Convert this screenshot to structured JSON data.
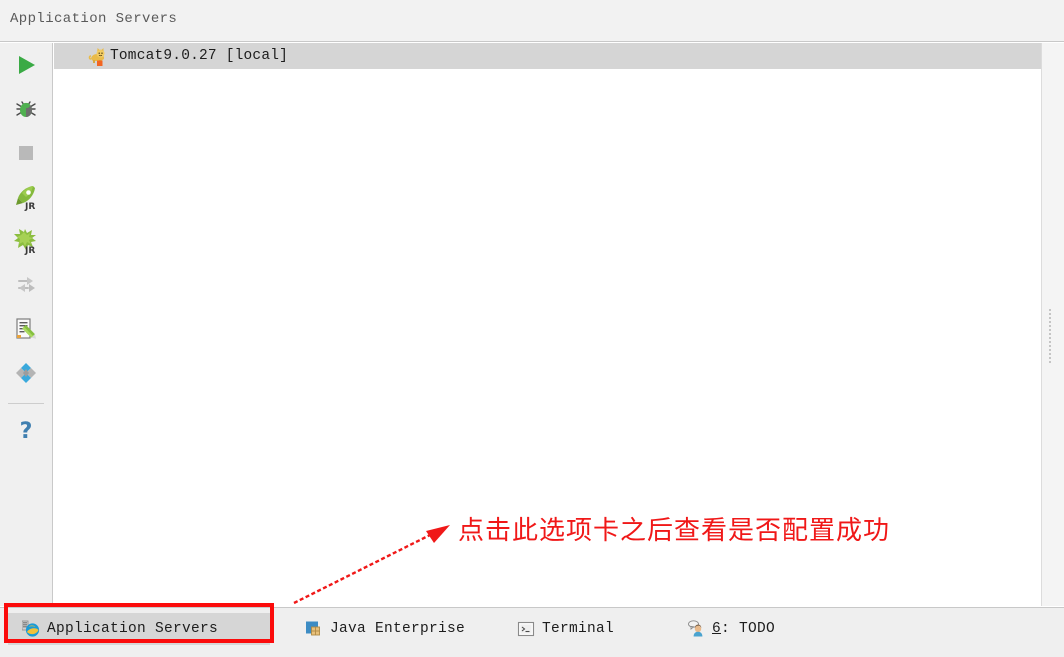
{
  "header": {
    "title": "Application Servers"
  },
  "toolbar": {
    "items": [
      {
        "name": "run-button",
        "icon": "run-play-icon",
        "tooltip": "Run"
      },
      {
        "name": "debug-button",
        "icon": "debug-bug-icon",
        "tooltip": "Debug"
      },
      {
        "name": "stop-button",
        "icon": "stop-square-icon",
        "tooltip": "Stop"
      },
      {
        "name": "deploy-button",
        "icon": "rocket-jr-icon",
        "tooltip": "Deploy"
      },
      {
        "name": "undeploy-button",
        "icon": "splat-jr-icon",
        "tooltip": "Undeploy"
      },
      {
        "name": "redeploy-button",
        "icon": "update-arrows-icon",
        "tooltip": "Update"
      },
      {
        "name": "edit-configuration-button",
        "icon": "edit-document-icon",
        "tooltip": "Edit Configuration"
      },
      {
        "name": "settings-button",
        "icon": "diamond-cluster-icon",
        "tooltip": "Settings"
      },
      {
        "name": "help-button",
        "icon": "question-mark-icon",
        "tooltip": "Help"
      }
    ]
  },
  "server_list": {
    "rows": [
      {
        "label": "Tomcat9.0.27 [local]",
        "icon": "tomcat-cat-icon",
        "selected": true
      }
    ]
  },
  "annotation": {
    "text": "点击此选项卡之后查看是否配置成功",
    "color": "#f01818",
    "arrow": "arrow-pointing-up-right"
  },
  "bottom_tabs": {
    "items": [
      {
        "label": "Application Servers",
        "icon": "app-servers-globe-icon",
        "active": true,
        "mnemonic": ""
      },
      {
        "label": "Java Enterprise",
        "icon": "java-enterprise-icon",
        "active": false,
        "mnemonic": ""
      },
      {
        "label": "Terminal",
        "icon": "terminal-icon",
        "active": false,
        "mnemonic": ""
      },
      {
        "label": ": TODO",
        "icon": "todo-person-icon",
        "active": false,
        "mnemonic": "6"
      }
    ]
  },
  "colors": {
    "accent_red": "#fb0b0b",
    "selected_row": "#d5d5d5",
    "toolbar_bg": "#f0f0f0",
    "panel_bg": "#ffffff"
  }
}
